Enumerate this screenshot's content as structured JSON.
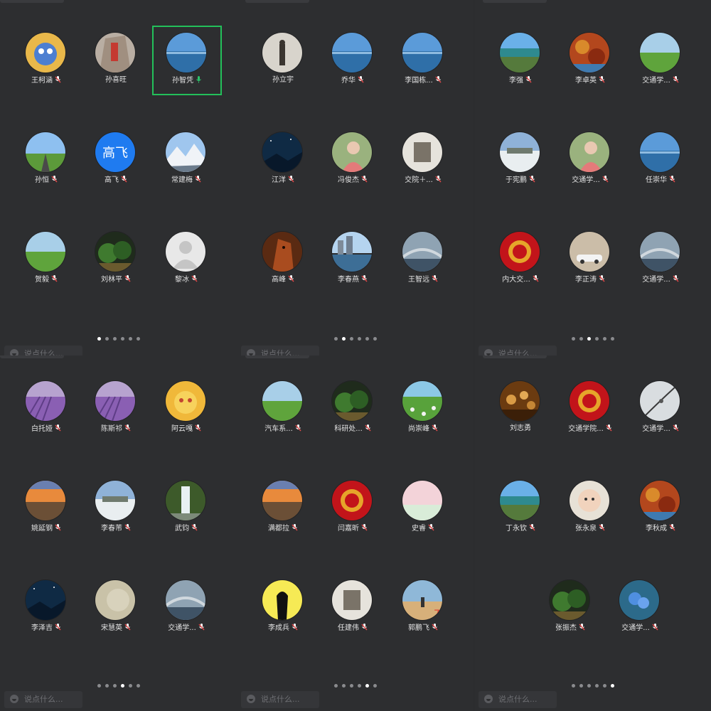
{
  "chat_placeholder": "说点什么...",
  "colors": {
    "background": "#2b2c2e",
    "active_border": "#23c05a",
    "dot_active": "#ffffff",
    "dot_inactive": "#8a8b8e",
    "mic_active": "#2cc36b",
    "mic_muted": "#e14b4b"
  },
  "panels": [
    {
      "dots": {
        "count": 6,
        "active": 0
      },
      "participants": [
        {
          "name": "王柯涵",
          "mic": "muted",
          "avatar": "cartoon"
        },
        {
          "name": "孙喜旺",
          "mic": "none",
          "avatar": "rock"
        },
        {
          "name": "孙智凭",
          "mic": "speaking",
          "avatar": "lake",
          "active": true
        },
        {
          "name": "孙恒",
          "mic": "muted",
          "avatar": "road"
        },
        {
          "name": "高飞",
          "mic": "muted",
          "avatar": "text",
          "avatar_text": "高飞"
        },
        {
          "name": "常建梅",
          "mic": "muted",
          "avatar": "mountain"
        },
        {
          "name": "贺毅",
          "mic": "muted",
          "avatar": "field"
        },
        {
          "name": "刘林平",
          "mic": "muted",
          "avatar": "forest"
        },
        {
          "name": "黎冰",
          "mic": "muted",
          "avatar": "default"
        }
      ]
    },
    {
      "dots": {
        "count": 6,
        "active": 1
      },
      "participants": [
        {
          "name": "孙立宇",
          "mic": "none",
          "avatar": "person"
        },
        {
          "name": "乔华",
          "mic": "muted",
          "avatar": "lake"
        },
        {
          "name": "李国栋...",
          "mic": "muted",
          "avatar": "lake"
        },
        {
          "name": "江洋",
          "mic": "muted",
          "avatar": "night"
        },
        {
          "name": "冯俊杰",
          "mic": "muted",
          "avatar": "portrait"
        },
        {
          "name": "交院＋...",
          "mic": "muted",
          "avatar": "photo"
        },
        {
          "name": "高峰",
          "mic": "muted",
          "avatar": "horse"
        },
        {
          "name": "李春燕",
          "mic": "muted",
          "avatar": "city"
        },
        {
          "name": "王智远",
          "mic": "muted",
          "avatar": "bridge"
        }
      ]
    },
    {
      "dots": {
        "count": 6,
        "active": 2
      },
      "participants": [
        {
          "name": "李强",
          "mic": "muted",
          "avatar": "coast"
        },
        {
          "name": "李卓英",
          "mic": "muted",
          "avatar": "autumn"
        },
        {
          "name": "交通学...",
          "mic": "muted",
          "avatar": "field"
        },
        {
          "name": "于宪鹏",
          "mic": "muted",
          "avatar": "snow"
        },
        {
          "name": "交通学...",
          "mic": "muted",
          "avatar": "portrait"
        },
        {
          "name": "任崇华",
          "mic": "muted",
          "avatar": "lake"
        },
        {
          "name": "内大交...",
          "mic": "muted",
          "avatar": "red"
        },
        {
          "name": "李正涛",
          "mic": "muted",
          "avatar": "car"
        },
        {
          "name": "交通学...",
          "mic": "muted",
          "avatar": "bridge"
        }
      ]
    },
    {
      "dots": {
        "count": 6,
        "active": 3
      },
      "participants": [
        {
          "name": "白托娅",
          "mic": "muted",
          "avatar": "lavender"
        },
        {
          "name": "陈斯祁",
          "mic": "muted",
          "avatar": "lavender"
        },
        {
          "name": "阿云嘎",
          "mic": "muted",
          "avatar": "sun"
        },
        {
          "name": "姚延钢",
          "mic": "muted",
          "avatar": "sunset"
        },
        {
          "name": "李春芾",
          "mic": "muted",
          "avatar": "snow"
        },
        {
          "name": "武钧",
          "mic": "muted",
          "avatar": "waterfall"
        },
        {
          "name": "李泽吉",
          "mic": "muted",
          "avatar": "night"
        },
        {
          "name": "宋慧英",
          "mic": "muted",
          "avatar": "pale"
        },
        {
          "name": "交通学...",
          "mic": "muted",
          "avatar": "bridge"
        }
      ]
    },
    {
      "dots": {
        "count": 6,
        "active": 4
      },
      "participants": [
        {
          "name": "汽车系...",
          "mic": "muted",
          "avatar": "field"
        },
        {
          "name": "科研处...",
          "mic": "muted",
          "avatar": "forest"
        },
        {
          "name": "尚崇峰",
          "mic": "muted",
          "avatar": "flowers"
        },
        {
          "name": "满都拉",
          "mic": "muted",
          "avatar": "sunset"
        },
        {
          "name": "闫嘉昕",
          "mic": "muted",
          "avatar": "red"
        },
        {
          "name": "史睿",
          "mic": "muted",
          "avatar": "pink"
        },
        {
          "name": "李成兵",
          "mic": "muted",
          "avatar": "silhouette"
        },
        {
          "name": "任建伟",
          "mic": "muted",
          "avatar": "photo"
        },
        {
          "name": "郭鹏飞",
          "mic": "muted",
          "avatar": "desert"
        }
      ]
    },
    {
      "dots": {
        "count": 6,
        "active": 5
      },
      "participants": [
        {
          "name": "刘志勇",
          "mic": "none",
          "avatar": "chess"
        },
        {
          "name": "交通学院...",
          "mic": "muted",
          "avatar": "red"
        },
        {
          "name": "交通学...",
          "mic": "muted",
          "avatar": "branch"
        },
        {
          "name": "丁永钦",
          "mic": "muted",
          "avatar": "coast"
        },
        {
          "name": "张永泉",
          "mic": "muted",
          "avatar": "baby"
        },
        {
          "name": "李秋成",
          "mic": "muted",
          "avatar": "autumn"
        },
        {
          "name": "张振杰",
          "mic": "muted",
          "avatar": "forest"
        },
        {
          "name": "交通学...",
          "mic": "muted",
          "avatar": "blueflower"
        }
      ]
    }
  ]
}
